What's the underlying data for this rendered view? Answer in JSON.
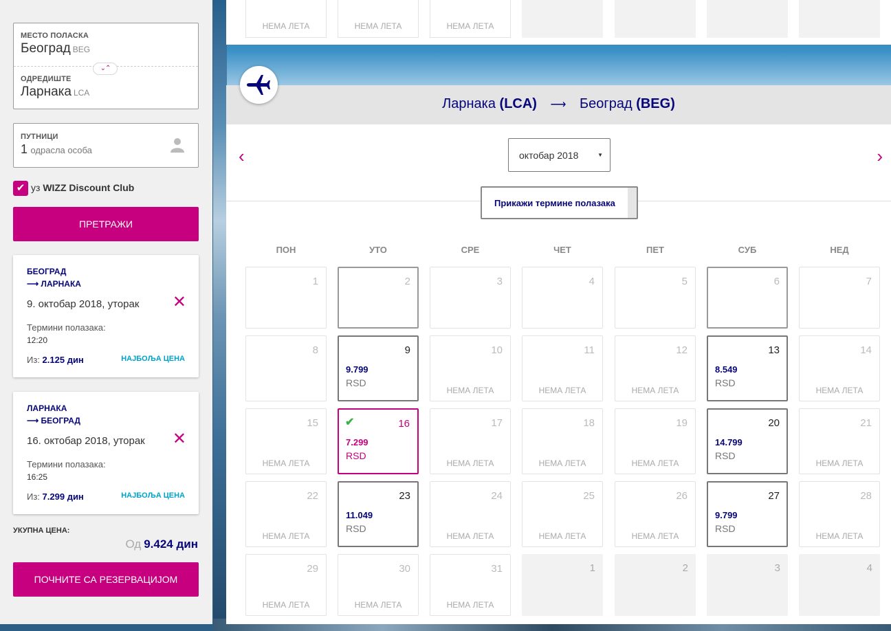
{
  "search": {
    "origin_label": "МЕСТО ПОЛАСКА",
    "origin_city": "Београд",
    "origin_code": "BEG",
    "dest_label": "ОДРЕДИШТЕ",
    "dest_city": "Ларнака",
    "dest_code": "LCA",
    "swap_glyph": "⌄⌃",
    "passengers_label": "ПУТНИЦИ",
    "passengers_count": "1",
    "passengers_text": "одрасла особа",
    "wizz_prefix": "уз",
    "wizz_name": "WIZZ Discount Club",
    "search_button": "ПРЕТРАЖИ"
  },
  "flights": [
    {
      "from": "БЕОГРАД",
      "to": "⟶ ЛАРНАКА",
      "date": "9. октобар 2018, уторак",
      "terms_label": "Термини полазака:",
      "time": "12:20",
      "price_prefix": "Из:",
      "price": "2.125 дин",
      "best": "НАЈБОЉА ЦЕНА"
    },
    {
      "from": "ЛАРНАКА",
      "to": "⟶ БЕОГРАД",
      "date": "16. октобар 2018, уторак",
      "terms_label": "Термини полазака:",
      "time": "16:25",
      "price_prefix": "Из:",
      "price": "7.299 дин",
      "best": "НАЈБОЉА ЦЕНА"
    }
  ],
  "total": {
    "label": "УКУПНА ЦЕНА:",
    "prefix": "Од",
    "value": "9.424 дин"
  },
  "book_button": "ПОЧНИТЕ СА РЕЗЕРВАЦИЈОМ",
  "top_strip": {
    "no_flight": "НЕМА ЛЕТА"
  },
  "calendar": {
    "route_from": "Ларнака",
    "route_from_code": "(LCA)",
    "route_arrow": "⟶",
    "route_to": "Београд",
    "route_to_code": "(BEG)",
    "month": "октобар 2018",
    "show_terms": "Прикажи термине полазака",
    "weekdays": [
      "ПОН",
      "УТО",
      "СРЕ",
      "ЧЕТ",
      "ПЕТ",
      "СУБ",
      "НЕД"
    ],
    "no_flight": "НЕМА ЛЕТА",
    "currency": "RSD",
    "days": {
      "d1": "1",
      "d2": "2",
      "d3": "3",
      "d4": "4",
      "d5": "5",
      "d6": "6",
      "d7": "7",
      "d8": "8",
      "d9": "9",
      "d10": "10",
      "d11": "11",
      "d12": "12",
      "d13": "13",
      "d14": "14",
      "d15": "15",
      "d16": "16",
      "d17": "17",
      "d18": "18",
      "d19": "19",
      "d20": "20",
      "d21": "21",
      "d22": "22",
      "d23": "23",
      "d24": "24",
      "d25": "25",
      "d26": "26",
      "d27": "27",
      "d28": "28",
      "d29": "29",
      "d30": "30",
      "d31": "31",
      "n1": "1",
      "n2": "2",
      "n3": "3",
      "n4": "4"
    },
    "prices": {
      "d9": "9.799",
      "d13": "8.549",
      "d16": "7.299",
      "d20": "14.799",
      "d23": "11.049",
      "d27": "9.799"
    }
  },
  "colors": {
    "brand": "#c6007e",
    "navy": "#06067a",
    "best_price": "#00a3c7",
    "check": "#3bb14a"
  }
}
